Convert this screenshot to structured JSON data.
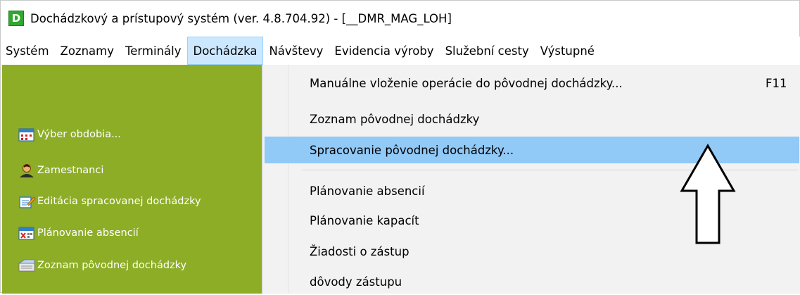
{
  "window": {
    "title": "Dochádzkový a prístupový systém (ver. 4.8.704.92) - [__DMR_MAG_LOH]",
    "app_icon_letter": "D"
  },
  "menubar": {
    "items": [
      {
        "label": "Systém"
      },
      {
        "label": "Zoznamy"
      },
      {
        "label": "Terminály"
      },
      {
        "label": "Dochádzka"
      },
      {
        "label": "Návštevy"
      },
      {
        "label": "Evidencia výroby"
      },
      {
        "label": "Služební cesty"
      },
      {
        "label": "Výstupné"
      }
    ],
    "active_index": 3
  },
  "sidebar": {
    "background": "#8dad27",
    "items": [
      {
        "label": "Výber obdobia...",
        "icon": "calendar-icon"
      },
      {
        "label": "Zamestnanci",
        "icon": "person-icon"
      },
      {
        "label": "Editácia spracovanej dochádzky",
        "icon": "edit-document-icon"
      },
      {
        "label": "Plánovanie absencií",
        "icon": "calendar-absence-icon"
      },
      {
        "label": "Zoznam pôvodnej dochádzky",
        "icon": "list-folder-icon"
      }
    ]
  },
  "dropdown": {
    "items": [
      {
        "label": "Manuálne vloženie operácie do pôvodnej dochádzky...",
        "shortcut": "F11"
      },
      {
        "label": "Zoznam pôvodnej dochádzky"
      },
      {
        "label": "Spracovanie pôvodnej dochádzky...",
        "highlighted": true
      },
      {
        "label": "Plánovanie absencií"
      },
      {
        "label": "Plánovanie kapacít"
      },
      {
        "label": "Žiadosti o zástup"
      },
      {
        "label": "dôvody zástupu"
      }
    ],
    "highlight_color": "#91c9f7"
  },
  "annotation": {
    "icon": "up-arrow-icon",
    "points_to": "Spracovanie pôvodnej dochádzky..."
  }
}
